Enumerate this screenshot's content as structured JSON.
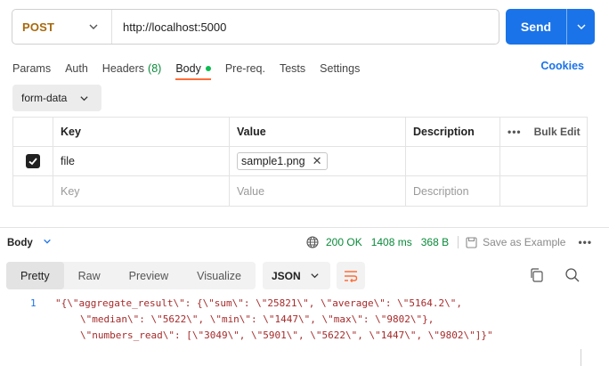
{
  "request": {
    "method": "POST",
    "url": "http://localhost:5000",
    "send_label": "Send"
  },
  "tabs": [
    {
      "label": "Params"
    },
    {
      "label": "Auth"
    },
    {
      "label": "Headers",
      "count": "(8)"
    },
    {
      "label": "Body",
      "active": true
    },
    {
      "label": "Pre-req."
    },
    {
      "label": "Tests"
    },
    {
      "label": "Settings"
    }
  ],
  "cookies_label": "Cookies",
  "body_mode": "form-data",
  "table": {
    "headers": [
      "Key",
      "Value",
      "Description"
    ],
    "bulk_edit": "Bulk Edit",
    "row": {
      "key": "file",
      "value": "sample1.png",
      "checked": true
    },
    "placeholder": {
      "key": "Key",
      "value": "Value",
      "description": "Description"
    }
  },
  "response": {
    "label": "Body",
    "status": "200 OK",
    "time": "1408 ms",
    "size": "368 B",
    "save_example": "Save as Example"
  },
  "view_tabs": [
    "Pretty",
    "Raw",
    "Preview",
    "Visualize"
  ],
  "format": "JSON",
  "code": {
    "line_number": "1",
    "lines": [
      "\"{\\\"aggregate_result\\\": {\\\"sum\\\": \\\"25821\\\", \\\"average\\\": \\\"5164.2\\\",",
      "\\\"median\\\": \\\"5622\\\", \\\"min\\\": \\\"1447\\\", \\\"max\\\": \\\"9802\\\"},",
      "\\\"numbers_read\\\": [\\\"3049\\\", \\\"5901\\\", \\\"5622\\\", \\\"1447\\\", \\\"9802\\\"]}\""
    ]
  },
  "colors": {
    "method": "#a6690d",
    "send": "#1a73e8",
    "active_tab": "#ff6c37",
    "status": "#0a8a3a",
    "code_string": "#a62a2a"
  }
}
